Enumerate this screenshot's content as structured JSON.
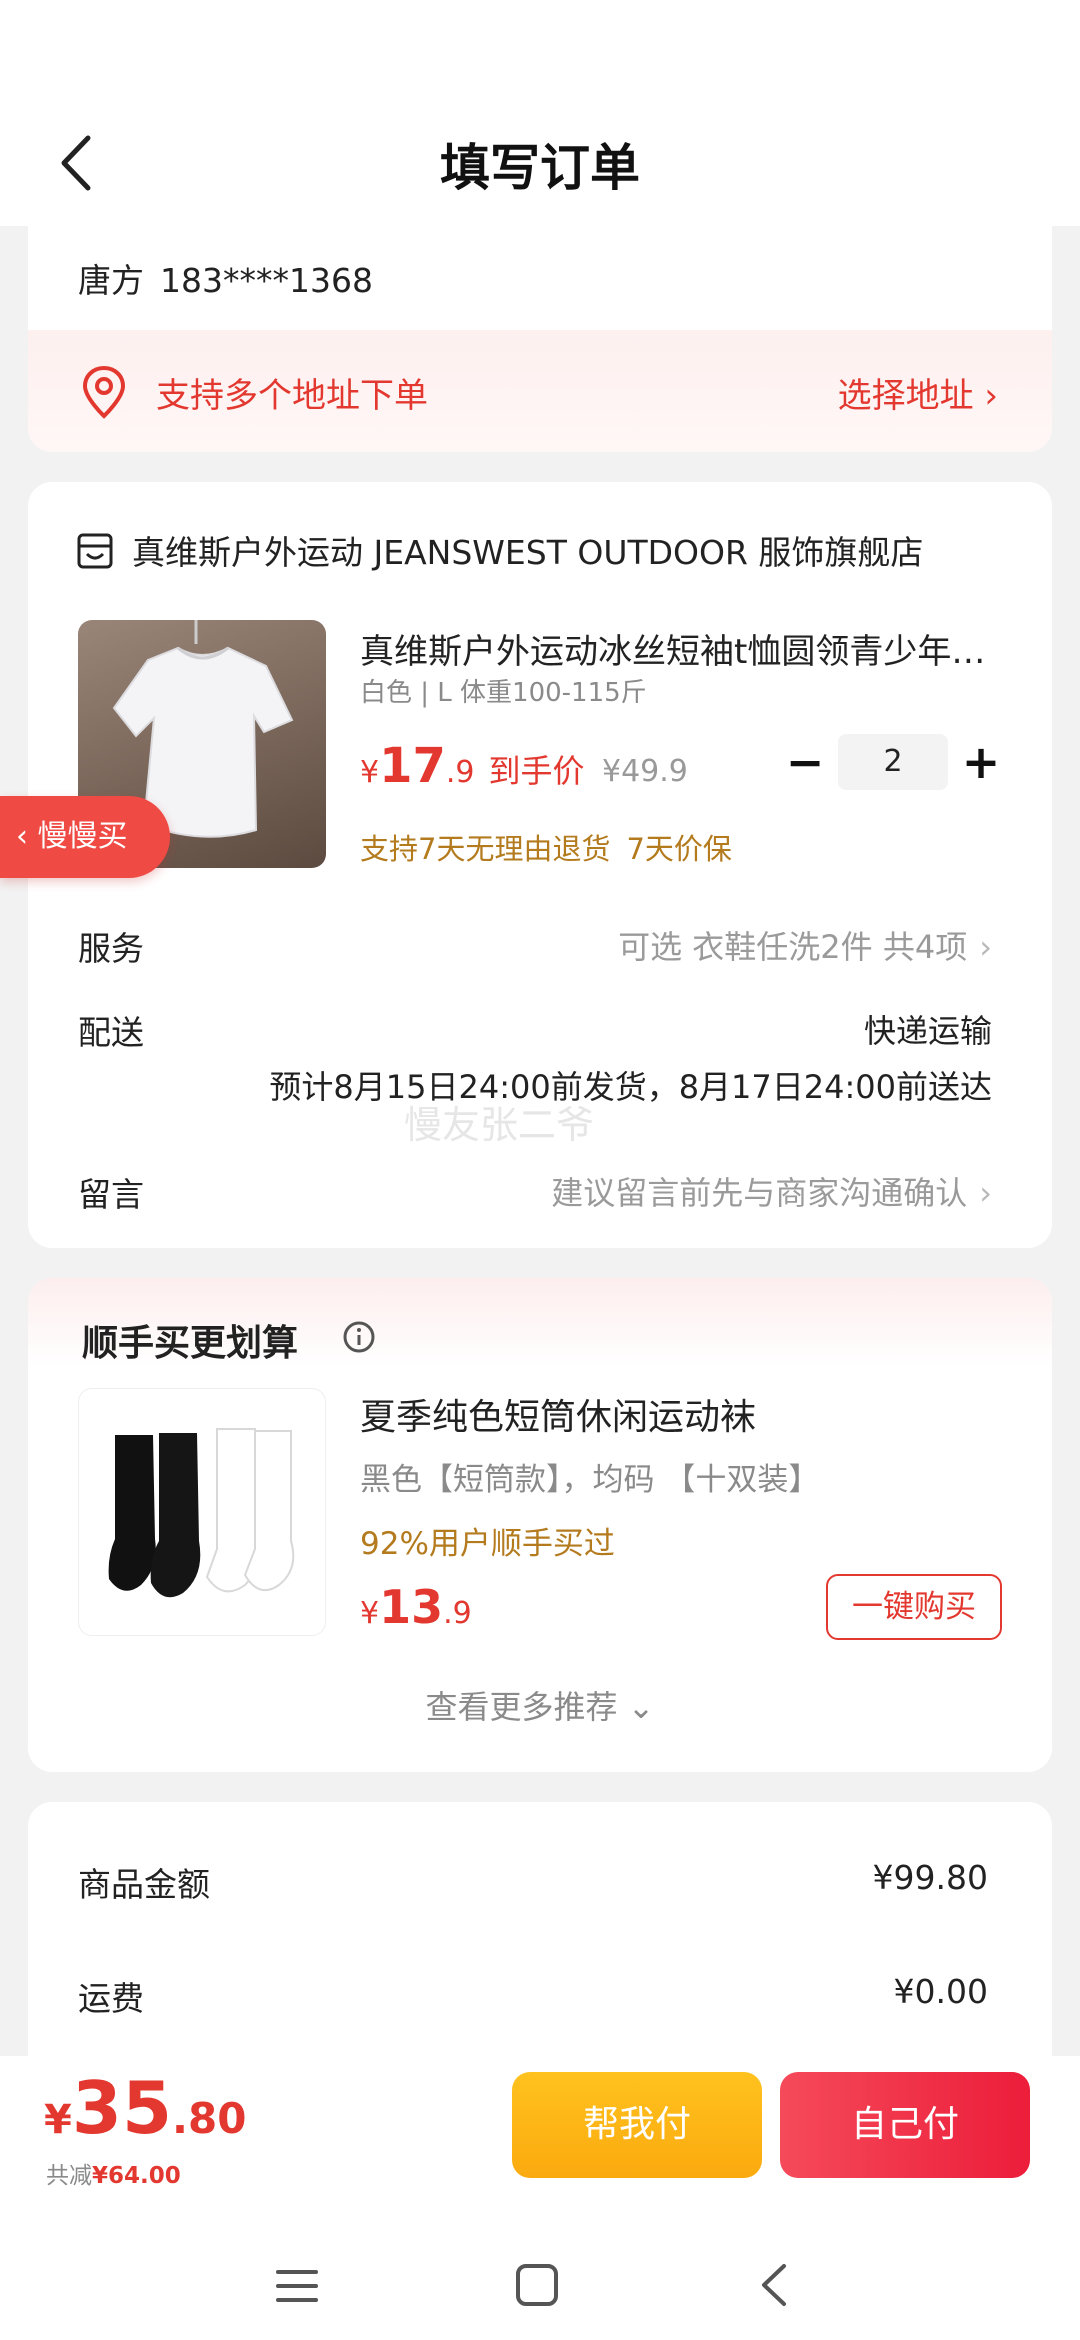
{
  "header": {
    "title": "填写订单"
  },
  "address": {
    "name": "唐方",
    "phone": "183****1368",
    "multi_label": "支持多个地址下单",
    "choose_label": "选择地址 ›"
  },
  "shop": {
    "name": "真维斯户外运动 JEANSWEST OUTDOOR 服饰旗舰店"
  },
  "product": {
    "title": "真维斯户外运动冰丝短袖t恤圆领青少年男女夏季运动休闲上衣",
    "spec": "白色 | L 体重100-115斤",
    "price_symbol": "¥",
    "price_int": "17",
    "price_dec": ".9",
    "price_tag": "到手价",
    "original_price": "¥49.9",
    "quantity": "2",
    "minus": "−",
    "plus": "+",
    "tags": [
      "支持7天无理由退货",
      "7天价保"
    ]
  },
  "service": {
    "label": "服务",
    "value": "可选 衣鞋任洗2件 共4项",
    "chevron": "›"
  },
  "delivery": {
    "label": "配送",
    "method": "快递运输",
    "estimate": "预计8月15日24:00前发货，8月17日24:00前送达"
  },
  "watermark": "慢友张二爷",
  "message": {
    "label": "留言",
    "placeholder": "建议留言前先与商家沟通确认",
    "chevron": "›"
  },
  "side_float": {
    "label": "慢慢买",
    "chevron": "‹"
  },
  "recommend": {
    "title": "顺手买更划算",
    "item_name": "夏季纯色短筒休闲运动袜",
    "item_spec": "黑色【短筒款】，均码 【十双装】",
    "item_stat": "92%用户顺手买过",
    "price_symbol": "¥",
    "price_int": "13",
    "price_dec": ".9",
    "buy_label": "一键购买",
    "more_label": "查看更多推荐 ⌄"
  },
  "totals": {
    "goods_label": "商品金额",
    "goods_value": "¥99.80",
    "shipping_label": "运费",
    "shipping_value": "¥0.00"
  },
  "bottom": {
    "price_symbol": "¥",
    "price_int": "35",
    "price_dec": ".80",
    "discount_label": "共减",
    "discount_value": "¥64.00",
    "help_pay": "帮我付",
    "self_pay": "自己付"
  },
  "colors": {
    "accent": "#e3382f",
    "gold": "#b47b1e",
    "help_btn": "#fbb414",
    "self_btn": "#ef2b45"
  }
}
